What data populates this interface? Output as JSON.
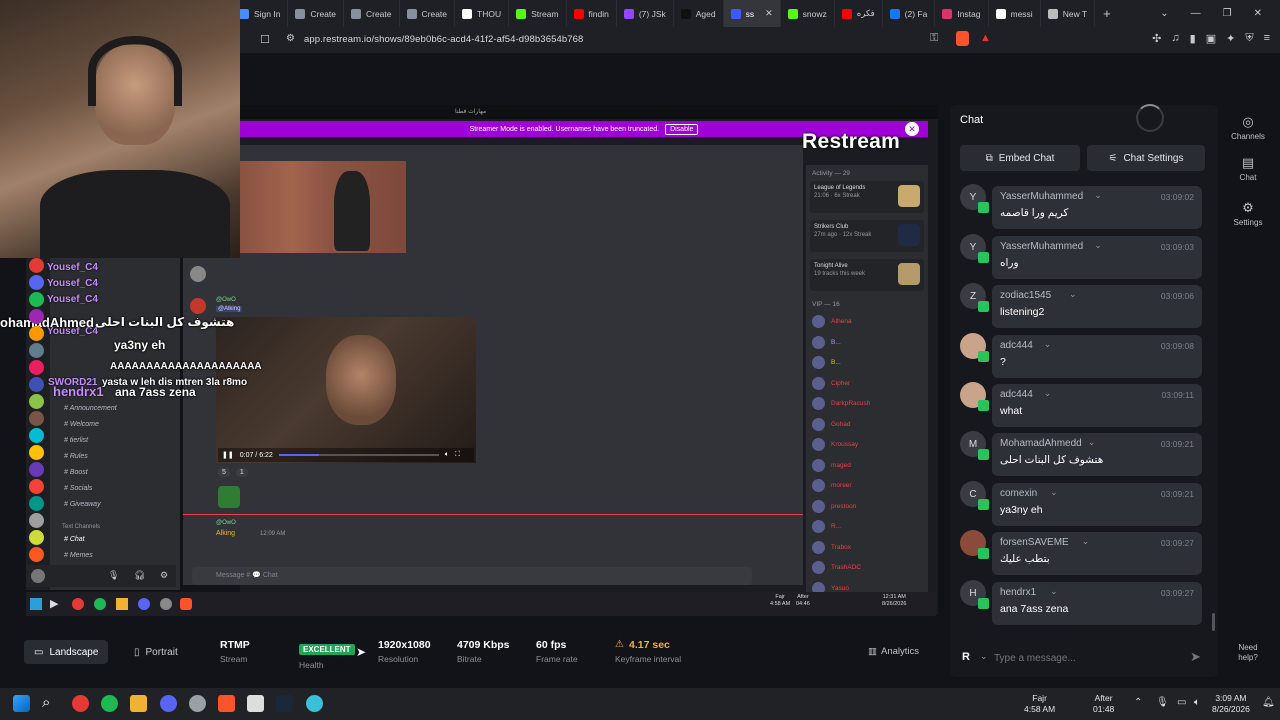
{
  "browser": {
    "tabs": [
      {
        "label": "Sign In",
        "color": "#4a8cff"
      },
      {
        "label": "Create",
        "color": "#8a8fa0"
      },
      {
        "label": "Create",
        "color": "#8a8fa0"
      },
      {
        "label": "Create",
        "color": "#8a8fa0"
      },
      {
        "label": "THOU",
        "color": "#ffffff"
      },
      {
        "label": "Stream",
        "color": "#53fc18"
      },
      {
        "label": "findin",
        "color": "#ff0000"
      },
      {
        "label": "(7) JSk",
        "color": "#9146ff"
      },
      {
        "label": "Aged",
        "color": "#111111"
      },
      {
        "label": "ss",
        "color": "#3a5cff",
        "active": true
      },
      {
        "label": "snowz",
        "color": "#53fc18"
      },
      {
        "label": "فكره",
        "color": "#ff0000"
      },
      {
        "label": "(2) Fa",
        "color": "#1877f2"
      },
      {
        "label": "Instag",
        "color": "#e1306c"
      },
      {
        "label": "messi",
        "color": "#ffffff"
      },
      {
        "label": "New T",
        "color": "#bbbbbb"
      }
    ],
    "url": "app.restream.io/shows/89eb0b6c-acd4-41f2-af54-d98b3654b768"
  },
  "video": {
    "window_title": "مهارات فطنا",
    "streamer_notice": "Streamer Mode is enabled. Usernames have been truncated.",
    "disable_label": "Disable",
    "watermark": "Restream",
    "video_time": "0:07 / 6:22",
    "reactions": [
      "5",
      "1"
    ],
    "message_placeholder": "Message # 💬 Chat",
    "reply_name": "@OwO",
    "reply_target": "@Alking",
    "reply_user": "Alking",
    "reply_time": "12:09 AM",
    "activity_header": "Activity — 29",
    "activity": [
      {
        "name": "League of Legends",
        "sub": "21:06 · 6x Streak",
        "color": "#c8aa6e"
      },
      {
        "name": "Strikers Club",
        "sub": "27m ago · 12x Streak",
        "color": "#1f2a44"
      },
      {
        "name": "Tonight Alive",
        "sub": "19 tracks this week",
        "color": "#b59a6a"
      }
    ],
    "vip_header": "VIP — 16",
    "vip": [
      "Athena",
      "B...",
      "B...",
      "Cipher",
      "DarkpRacush",
      "Gohad",
      "Kroussay",
      "maged",
      "moreer",
      "prestoon",
      "R...",
      "Trabox",
      "TrashADC",
      "Yasuo"
    ],
    "channels": [
      "Announcement",
      "Welcome",
      "tierlist",
      "Rules",
      "Boost",
      "Socials",
      "Giveaway",
      "Chat",
      "Memes"
    ],
    "text_channels_label": "Text Channels",
    "inner_clock": {
      "prayer": "Fajr",
      "prayer_time": "4:58 AM",
      "after": "After",
      "after_time": "04:46",
      "time": "12:31 AM",
      "date": "8/26/2026"
    }
  },
  "overlay": {
    "names": [
      "Yousef_C4",
      "Yousef_C4",
      "Yousef_C4",
      "Yousef_C4",
      "SWORD21",
      "hendrx1"
    ],
    "lines": [
      "هتشوف كل البنات احلى",
      "ya3ny eh",
      "AAAAAAAAAAAAAAAAAAAAA",
      "yasta w leh dis mtren 3la r8mo",
      "ana 7ass zena"
    ],
    "left_name": "ohamadAhmed"
  },
  "chat": {
    "title": "Chat",
    "embed_label": "Embed Chat",
    "settings_label": "Chat Settings",
    "messages": [
      {
        "user": "YasserMuhammed",
        "time": "03:09:02",
        "text": "كريم ورا قاصمه",
        "avatar": "Y"
      },
      {
        "user": "YasserMuhammed",
        "time": "03:09:03",
        "text": "وراه",
        "avatar": "Y"
      },
      {
        "user": "zodiac1545",
        "time": "03:09:06",
        "text": "listening2",
        "avatar": "Z"
      },
      {
        "user": "adc444",
        "time": "03:09:08",
        "text": "?",
        "avatar": ""
      },
      {
        "user": "adc444",
        "time": "03:09:11",
        "text": "what",
        "avatar": ""
      },
      {
        "user": "MohamadAhmedd",
        "time": "03:09:21",
        "text": "هتشوف كل البنات احلى",
        "avatar": "M"
      },
      {
        "user": "comexin",
        "time": "03:09:21",
        "text": "ya3ny eh",
        "avatar": "C"
      },
      {
        "user": "forsenSAVEME",
        "time": "03:09:27",
        "text": "بتطب عليك",
        "avatar": ""
      },
      {
        "user": "hendrx1",
        "time": "03:09:27",
        "text": "ana 7ass zena",
        "avatar": "H"
      }
    ],
    "input_placeholder": "Type a message...",
    "platform_letter": "R"
  },
  "sidenav": [
    {
      "label": "Channels",
      "icon": "broadcast-icon"
    },
    {
      "label": "Chat",
      "icon": "chat-icon"
    },
    {
      "label": "Settings",
      "icon": "gear-icon"
    }
  ],
  "help_label": "Need help?",
  "bottom": {
    "landscape_label": "Landscape",
    "portrait_label": "Portrait",
    "stats": [
      {
        "value": "RTMP",
        "label": "Stream"
      },
      {
        "value": "EXCELLENT",
        "label": "Health",
        "badge": true
      },
      {
        "value": "1920x1080",
        "label": "Resolution"
      },
      {
        "value": "4709 Kbps",
        "label": "Bitrate"
      },
      {
        "value": "60 fps",
        "label": "Frame rate"
      },
      {
        "value": "4.17 sec",
        "label": "Keyframe interval",
        "warn": true
      }
    ],
    "analytics_label": "Analytics"
  },
  "taskbar": {
    "prayer": "Fajr",
    "prayer_time": "4:58 AM",
    "after": "After",
    "after_time": "01:48",
    "time": "3:09 AM",
    "date": "8/26/2026"
  },
  "colors": {
    "accent_green": "#28c35a",
    "streamer_purple": "#a000d8",
    "health_green": "#23a559",
    "warn_orange": "#f0b232"
  }
}
